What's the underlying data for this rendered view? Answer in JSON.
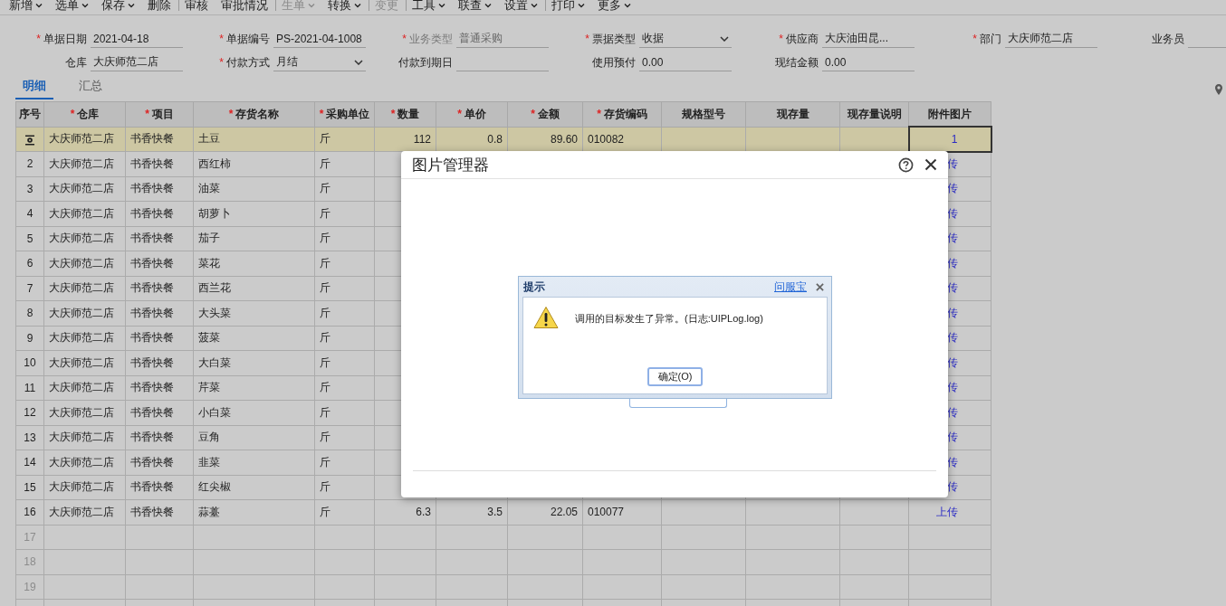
{
  "toolbar": [
    {
      "label": "新增",
      "dropdown": true,
      "disabled": false,
      "separator_before": false
    },
    {
      "label": "选单",
      "dropdown": true,
      "disabled": false,
      "separator_before": false
    },
    {
      "label": "保存",
      "dropdown": true,
      "disabled": false,
      "separator_before": false
    },
    {
      "label": "删除",
      "dropdown": false,
      "disabled": false,
      "separator_before": false
    },
    {
      "label": "审核",
      "dropdown": false,
      "disabled": false,
      "separator_before": true
    },
    {
      "label": "审批情况",
      "dropdown": false,
      "disabled": false,
      "separator_before": false
    },
    {
      "label": "生单",
      "dropdown": true,
      "disabled": true,
      "separator_before": true
    },
    {
      "label": "转换",
      "dropdown": true,
      "disabled": false,
      "separator_before": false
    },
    {
      "label": "变更",
      "dropdown": false,
      "disabled": true,
      "separator_before": true
    },
    {
      "label": "工具",
      "dropdown": true,
      "disabled": false,
      "separator_before": true
    },
    {
      "label": "联查",
      "dropdown": true,
      "disabled": false,
      "separator_before": false
    },
    {
      "label": "设置",
      "dropdown": true,
      "disabled": false,
      "separator_before": false
    },
    {
      "label": "打印",
      "dropdown": true,
      "disabled": false,
      "separator_before": true
    },
    {
      "label": "更多",
      "dropdown": true,
      "disabled": false,
      "separator_before": false
    }
  ],
  "form_rows": [
    [
      {
        "mark": "*",
        "label": "单据日期",
        "value": "2021-04-18",
        "disabled": false
      },
      {
        "mark": "*",
        "label": "单据编号",
        "value": "PS-2021-04-1008",
        "disabled": false
      },
      {
        "mark": "*",
        "label": "业务类型",
        "value": "普通采购",
        "disabled": true
      },
      {
        "mark": "*",
        "label": "票据类型",
        "value": "收据",
        "dropdown": true,
        "disabled": false
      },
      {
        "mark": "*",
        "label": "供应商",
        "value": "大庆油田昆...",
        "disabled": false
      },
      {
        "mark": "*",
        "label": "部门",
        "value": "大庆师范二店",
        "disabled": false
      },
      {
        "label": "业务员",
        "disabled": false
      }
    ],
    [
      {
        "label": "仓库",
        "value": "大庆师范二店",
        "disabled": false
      },
      {
        "mark": "*",
        "label": "付款方式",
        "value": "月结",
        "dropdown": true,
        "disabled": false
      },
      {
        "label": "付款到期日",
        "disabled": false
      },
      {
        "label": "使用预付",
        "value": "0.00",
        "disabled": false
      },
      {
        "label": "现结金额",
        "value": "0.00",
        "disabled": false
      }
    ]
  ],
  "tabs": [
    {
      "label": "明细",
      "selected": true
    },
    {
      "label": "汇总",
      "selected": false
    }
  ],
  "table": {
    "columns": [
      {
        "label": "序号"
      },
      {
        "mark": "*",
        "label": "仓库"
      },
      {
        "mark": "*",
        "label": "项目"
      },
      {
        "mark": "*",
        "label": "存货名称"
      },
      {
        "mark": "*",
        "label": "采购单位"
      },
      {
        "mark": "*",
        "label": "数量"
      },
      {
        "mark": "*",
        "label": "单价"
      },
      {
        "mark": "*",
        "label": "金额"
      },
      {
        "mark": "*",
        "label": "存货编码"
      },
      {
        "label": "规格型号"
      },
      {
        "label": "现存量"
      },
      {
        "label": "现存量说明"
      },
      {
        "label": "附件图片"
      }
    ],
    "rows": [
      {
        "kind": "data",
        "selected": true,
        "warehouse": "大庆师范二店",
        "project": "书香快餐",
        "name": "土豆",
        "unit": "斤",
        "qty": "112",
        "price": "0.8",
        "amount": "89.60",
        "code": "010082",
        "attach": "1"
      },
      {
        "kind": "data",
        "selected": false,
        "no": "2",
        "warehouse": "大庆师范二店",
        "project": "书香快餐",
        "name": "西红柿",
        "unit": "斤",
        "attach": "传"
      },
      {
        "kind": "data",
        "selected": false,
        "no": "3",
        "warehouse": "大庆师范二店",
        "project": "书香快餐",
        "name": "油菜",
        "unit": "斤",
        "attach": "传"
      },
      {
        "kind": "data",
        "selected": false,
        "no": "4",
        "warehouse": "大庆师范二店",
        "project": "书香快餐",
        "name": "胡萝卜",
        "unit": "斤",
        "attach": "传"
      },
      {
        "kind": "data",
        "selected": false,
        "no": "5",
        "warehouse": "大庆师范二店",
        "project": "书香快餐",
        "name": "茄子",
        "unit": "斤",
        "attach": "传"
      },
      {
        "kind": "data",
        "selected": false,
        "no": "6",
        "warehouse": "大庆师范二店",
        "project": "书香快餐",
        "name": "菜花",
        "unit": "斤",
        "attach": "传"
      },
      {
        "kind": "data",
        "selected": false,
        "no": "7",
        "warehouse": "大庆师范二店",
        "project": "书香快餐",
        "name": "西兰花",
        "unit": "斤",
        "attach": "传"
      },
      {
        "kind": "data",
        "selected": false,
        "no": "8",
        "warehouse": "大庆师范二店",
        "project": "书香快餐",
        "name": "大头菜",
        "unit": "斤",
        "attach": "传"
      },
      {
        "kind": "data",
        "selected": false,
        "no": "9",
        "warehouse": "大庆师范二店",
        "project": "书香快餐",
        "name": "菠菜",
        "unit": "斤",
        "attach": "传"
      },
      {
        "kind": "data",
        "selected": false,
        "no": "10",
        "warehouse": "大庆师范二店",
        "project": "书香快餐",
        "name": "大白菜",
        "unit": "斤",
        "attach": "传"
      },
      {
        "kind": "data",
        "selected": false,
        "no": "11",
        "warehouse": "大庆师范二店",
        "project": "书香快餐",
        "name": "芹菜",
        "unit": "斤",
        "attach": "传"
      },
      {
        "kind": "data",
        "selected": false,
        "no": "12",
        "warehouse": "大庆师范二店",
        "project": "书香快餐",
        "name": "小白菜",
        "unit": "斤",
        "attach": "传"
      },
      {
        "kind": "data",
        "selected": false,
        "no": "13",
        "warehouse": "大庆师范二店",
        "project": "书香快餐",
        "name": "豆角",
        "unit": "斤",
        "attach": "传"
      },
      {
        "kind": "data",
        "selected": false,
        "no": "14",
        "warehouse": "大庆师范二店",
        "project": "书香快餐",
        "name": "韭菜",
        "unit": "斤",
        "attach": "传"
      },
      {
        "kind": "data",
        "selected": false,
        "no": "15",
        "warehouse": "大庆师范二店",
        "project": "书香快餐",
        "name": "红尖椒",
        "unit": "斤",
        "attach": "传"
      },
      {
        "kind": "data",
        "selected": false,
        "no": "16",
        "warehouse": "大庆师范二店",
        "project": "书香快餐",
        "name": "蒜薹",
        "unit": "斤",
        "qty": "6.3",
        "price": "3.5",
        "amount": "22.05",
        "code": "010077",
        "attach": "上传"
      },
      {
        "kind": "blank",
        "selected": false,
        "no": "17"
      },
      {
        "kind": "blank",
        "selected": false,
        "no": "18"
      },
      {
        "kind": "blank",
        "selected": false,
        "no": "19"
      }
    ]
  },
  "image_manager": {
    "title": "图片管理器"
  },
  "alert": {
    "title": "提示",
    "link": "问服宝",
    "message": "调用的目标发生了异常。(日志:UIPLog.log)",
    "button": "确定(O)"
  }
}
